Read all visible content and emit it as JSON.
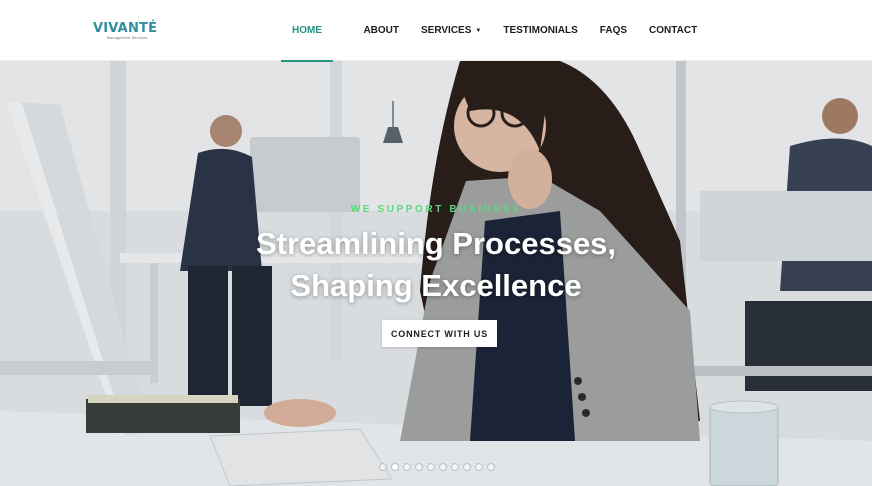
{
  "brand": {
    "name": "VIVANTÉ",
    "tagline": "Management Services",
    "color": "#2f8fa0"
  },
  "nav": {
    "items": [
      {
        "label": "HOME",
        "active": true
      },
      {
        "label": "ABOUT",
        "active": false
      },
      {
        "label": "SERVICES",
        "active": false,
        "has_dropdown": true
      },
      {
        "label": "TESTIMONIALS",
        "active": false
      },
      {
        "label": "FAQS",
        "active": false
      },
      {
        "label": "CONTACT",
        "active": false
      }
    ],
    "active_color": "#26927f"
  },
  "hero": {
    "eyebrow": "WE SUPPORT BUSINESS",
    "headline_line1": "Streamlining Processes,",
    "headline_line2": "Shaping Excellence",
    "cta_label": "CONNECT WITH US",
    "eyebrow_color": "#5fd67e",
    "slider": {
      "total_slides": 10,
      "active_index": 2
    }
  },
  "icons": {
    "dropdown": "chevron-down-icon"
  }
}
